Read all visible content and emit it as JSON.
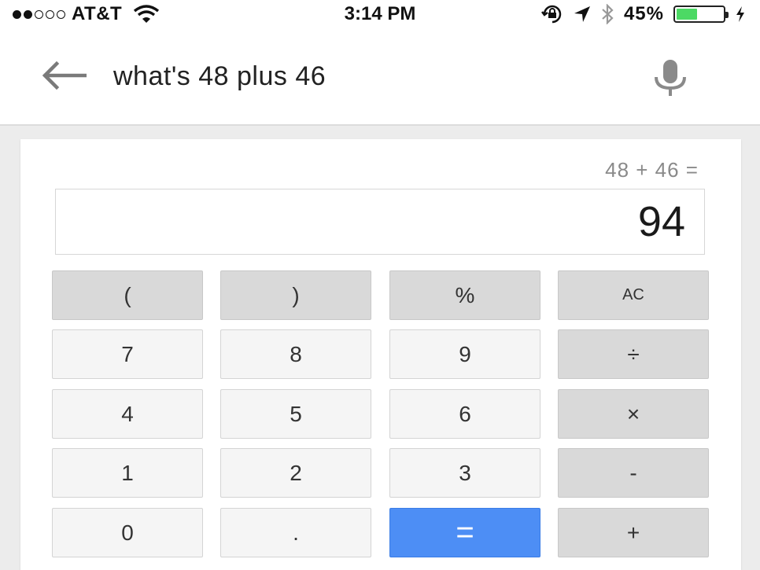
{
  "status_bar": {
    "carrier": "AT&T",
    "time": "3:14 PM",
    "battery_percent": "45%",
    "battery_level": 0.45,
    "icons": [
      "signal-dots-icon",
      "wifi-icon",
      "rotation-lock-icon",
      "location-arrow-icon",
      "bluetooth-icon",
      "battery-icon",
      "charging-bolt-icon"
    ]
  },
  "search": {
    "query": "what's 48 plus 46",
    "back_icon": "back-arrow-icon",
    "mic_icon": "microphone-icon"
  },
  "calculator": {
    "expression": "48 + 46 =",
    "result": "94",
    "keys": [
      {
        "label": "(",
        "style": "dark"
      },
      {
        "label": ")",
        "style": "dark"
      },
      {
        "label": "%",
        "style": "dark"
      },
      {
        "label": "AC",
        "style": "dark"
      },
      {
        "label": "7",
        "style": "light"
      },
      {
        "label": "8",
        "style": "light"
      },
      {
        "label": "9",
        "style": "light"
      },
      {
        "label": "÷",
        "style": "dark"
      },
      {
        "label": "4",
        "style": "light"
      },
      {
        "label": "5",
        "style": "light"
      },
      {
        "label": "6",
        "style": "light"
      },
      {
        "label": "×",
        "style": "dark"
      },
      {
        "label": "1",
        "style": "light"
      },
      {
        "label": "2",
        "style": "light"
      },
      {
        "label": "3",
        "style": "light"
      },
      {
        "label": "-",
        "style": "dark"
      },
      {
        "label": "0",
        "style": "light"
      },
      {
        "label": ".",
        "style": "light"
      },
      {
        "label": "=",
        "style": "blue"
      },
      {
        "label": "+",
        "style": "dark"
      }
    ]
  },
  "colors": {
    "equals_key": "#4d8ef5",
    "battery_fill": "#4cd964"
  }
}
